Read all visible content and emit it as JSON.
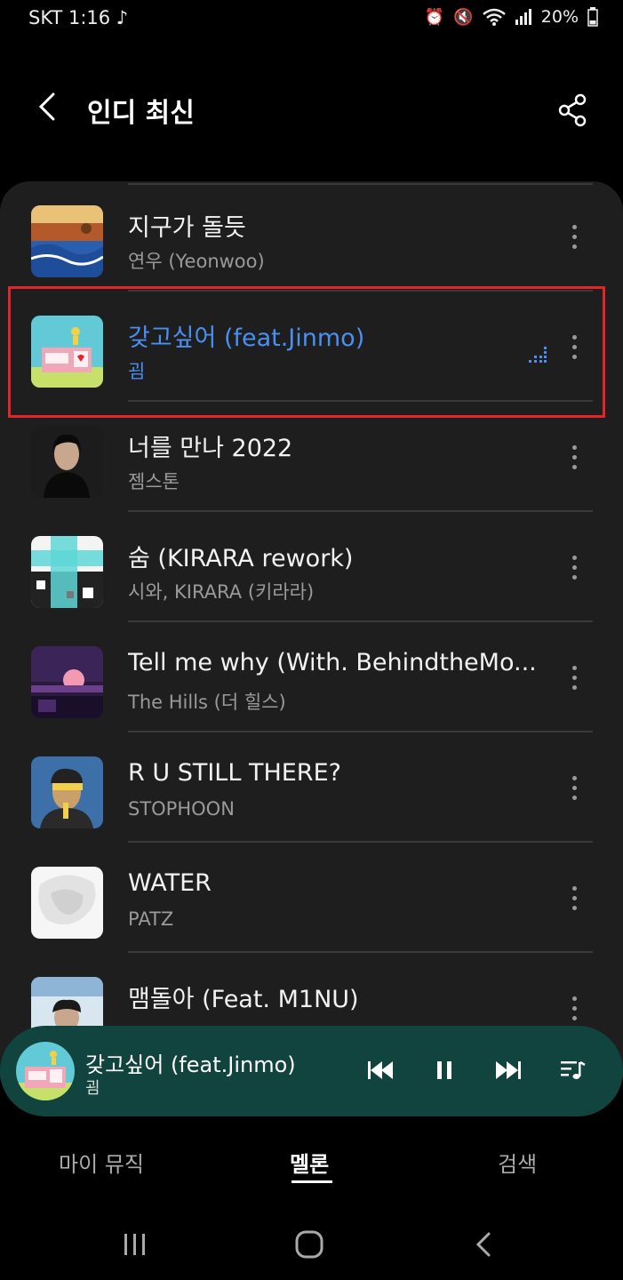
{
  "status_bar": {
    "left": "SKT 1:16 ♪",
    "battery": "20%"
  },
  "header": {
    "title": "인디 최신"
  },
  "songs": [
    {
      "title": "지구가 돌듯",
      "artist": "연우 (Yeonwoo)"
    },
    {
      "title": "갖고싶어 (feat.Jinmo)",
      "artist": "굄"
    },
    {
      "title": "너를 만나 2022",
      "artist": "젬스톤"
    },
    {
      "title": "숨 (KIRARA rework)",
      "artist": "시와, KIRARA (키라라)"
    },
    {
      "title": "Tell me why (With. BehindtheMo...",
      "artist": "The Hills (더 힐스)"
    },
    {
      "title": "R U STILL THERE?",
      "artist": "STOPHOON"
    },
    {
      "title": "WATER",
      "artist": "PATZ"
    },
    {
      "title": "맴돌아 (Feat. M1NU)",
      "artist": ""
    }
  ],
  "mini_player": {
    "title": "갖고싶어 (feat.Jinmo)",
    "artist": "굄"
  },
  "tabs": {
    "my_music": "마이 뮤직",
    "melon": "멜론",
    "search": "검색"
  },
  "colors": {
    "accent": "#4a90f2",
    "highlight_border": "#e3242b",
    "mini_player_bg": "#11443f"
  }
}
